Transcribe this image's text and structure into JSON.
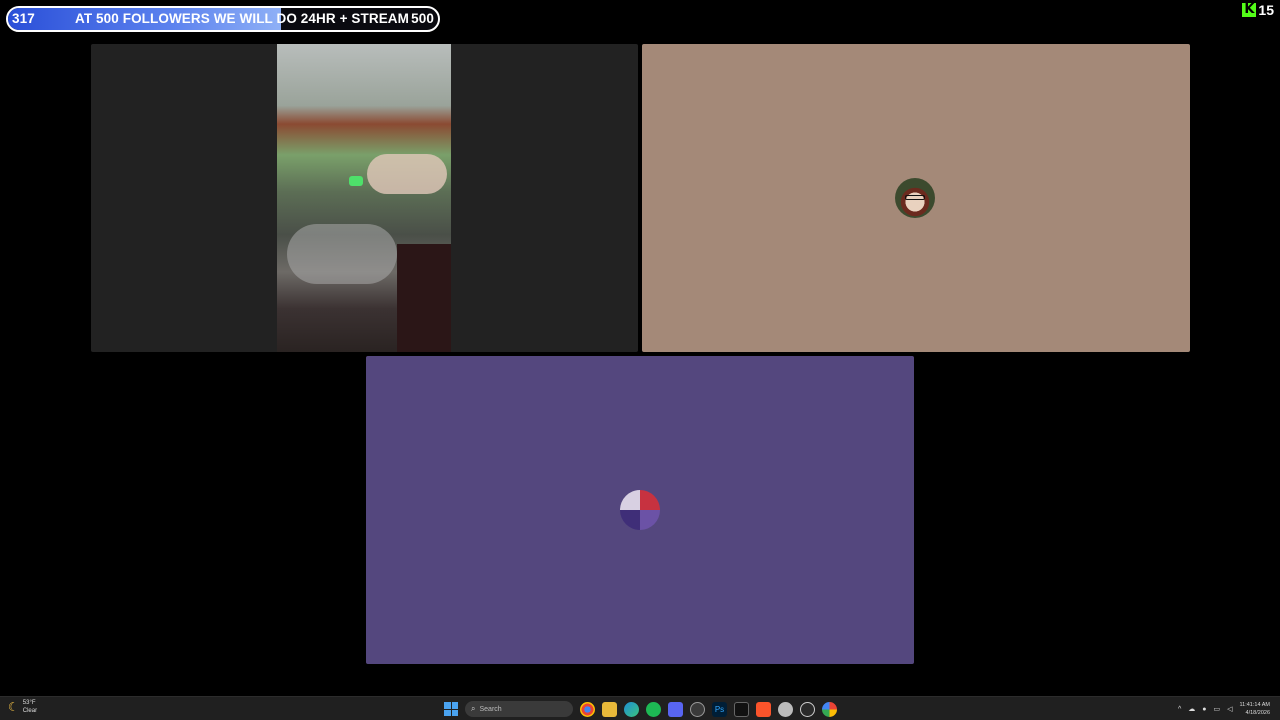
{
  "goal_bar": {
    "current": "317",
    "text": "AT 500 FOLLOWERS WE WILL DO 24HR + STREAM",
    "target": "500",
    "progress_fraction": 0.634,
    "fill_color": "#4a72e8"
  },
  "overlay_badge": {
    "logo_letter": "K",
    "count": "15",
    "logo_color": "#53fc18"
  },
  "tiles": [
    {
      "kind": "camera-video",
      "background": "#222222"
    },
    {
      "kind": "avatar",
      "background": "#a48978"
    },
    {
      "kind": "avatar",
      "background": "#54477e"
    }
  ],
  "taskbar": {
    "weather": {
      "temp": "53°F",
      "condition": "Clear"
    },
    "search_placeholder": "Search",
    "apps": [
      "chrome-icon",
      "file-explorer-icon",
      "edge-icon",
      "spotify-icon",
      "discord-icon",
      "obs-icon",
      "photoshop-icon",
      "terminal-icon",
      "brave-icon",
      "app-circle-icon",
      "steam-icon",
      "google-icon"
    ],
    "photoshop_label": "Ps",
    "clock": {
      "time": "11:41:14 AM",
      "date": "4/18/2026"
    }
  }
}
